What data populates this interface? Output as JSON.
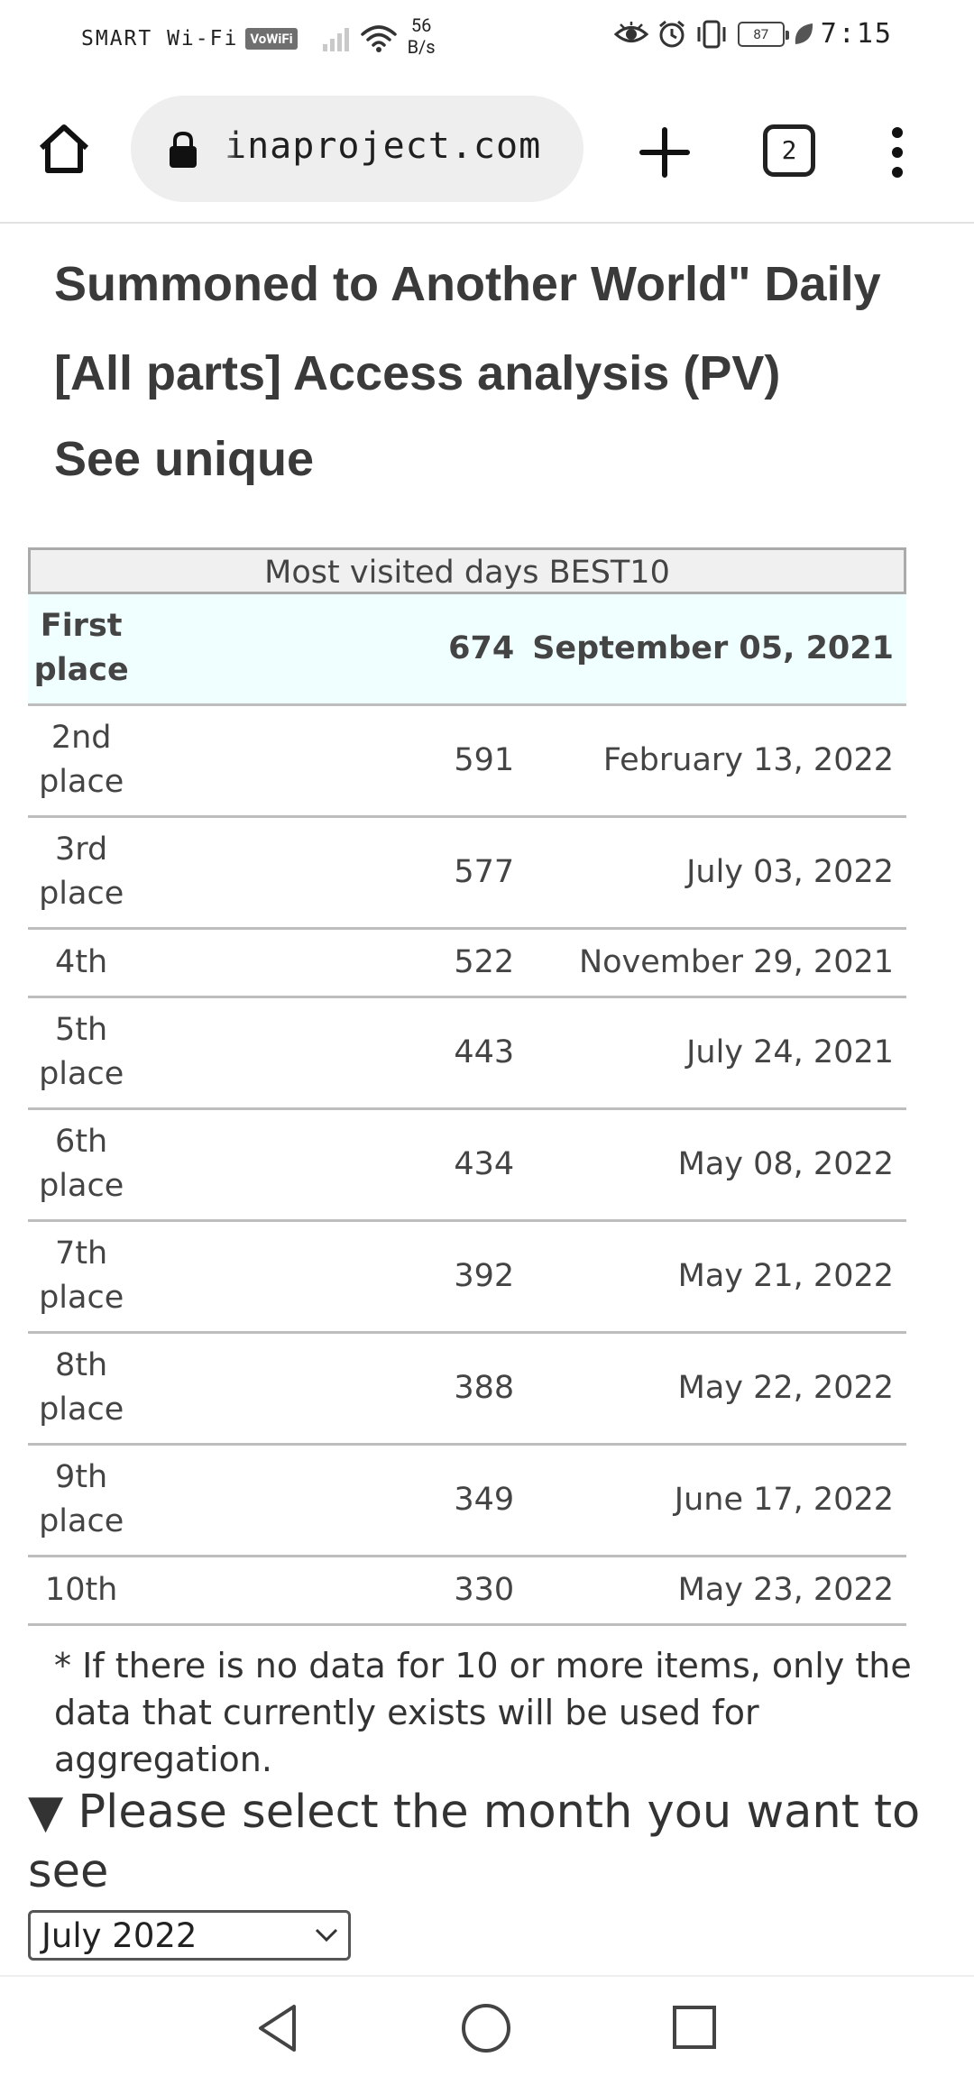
{
  "status_bar": {
    "carrier": "SMART Wi-Fi",
    "vowifi_badge": "VoWiFi",
    "net_speed_value": "56",
    "net_speed_unit": "B/s",
    "battery_level": "87",
    "time": "7:15",
    "icons": [
      "signal-icon",
      "wifi-icon",
      "eye-icon",
      "alarm-icon",
      "vibrate-icon",
      "battery-icon",
      "leaf-icon"
    ]
  },
  "browser": {
    "url": "inaproject.com",
    "tab_count": "2",
    "icons": [
      "home-icon",
      "lock-icon",
      "plus-icon",
      "tabs-icon",
      "more-vert-icon"
    ]
  },
  "page": {
    "title_line1": "Summoned to Another World\" Daily",
    "title_line2": "[All parts] Access analysis (PV)",
    "see_unique": "See unique",
    "table": {
      "caption": "Most visited days BEST10",
      "rows": [
        {
          "rank": "First place",
          "pv": "674",
          "date": "September 05, 2021"
        },
        {
          "rank": "2nd place",
          "pv": "591",
          "date": "February 13, 2022"
        },
        {
          "rank": "3rd place",
          "pv": "577",
          "date": "July 03, 2022"
        },
        {
          "rank": "4th",
          "pv": "522",
          "date": "November 29, 2021"
        },
        {
          "rank": "5th place",
          "pv": "443",
          "date": "July 24, 2021"
        },
        {
          "rank": "6th place",
          "pv": "434",
          "date": "May 08, 2022"
        },
        {
          "rank": "7th place",
          "pv": "392",
          "date": "May 21, 2022"
        },
        {
          "rank": "8th place",
          "pv": "388",
          "date": "May 22, 2022"
        },
        {
          "rank": "9th place",
          "pv": "349",
          "date": "June 17, 2022"
        },
        {
          "rank": "10th",
          "pv": "330",
          "date": "May 23, 2022"
        }
      ]
    },
    "note": "* If there is no data for 10 or more items, only the data that currently exists will be used for aggregation.",
    "select_label": "▼ Please select the month you want to see",
    "month_select": {
      "value": "July 2022"
    }
  },
  "nav_bar": {
    "icons": [
      "back-icon",
      "home-circle-icon",
      "recent-apps-icon"
    ]
  },
  "colors": {
    "first_row_bg": "#f0ffff",
    "caption_bg": "#f0f0f0",
    "url_bar_bg": "#eeeeef",
    "text": "#333333"
  }
}
